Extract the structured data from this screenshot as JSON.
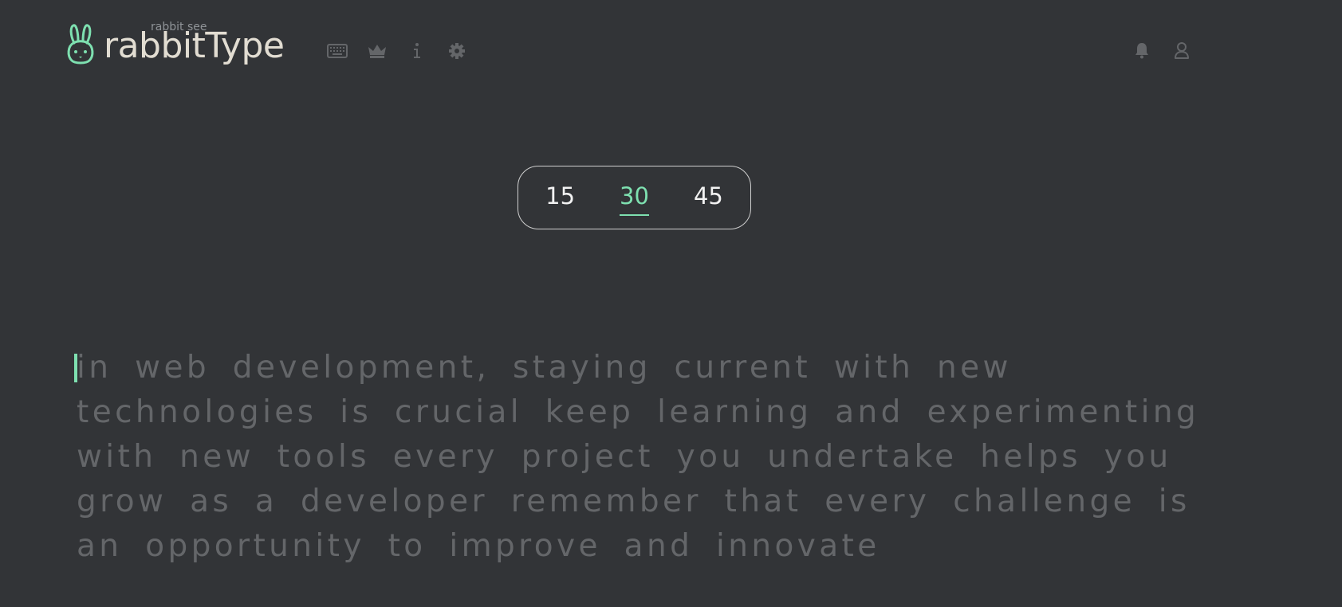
{
  "brand": {
    "subtitle": "rabbit see",
    "title": "rabbitType",
    "logo_icon": "rabbit-icon",
    "accent": "#7ee0b0"
  },
  "nav": {
    "icons": [
      "keyboard-icon",
      "crown-icon",
      "info-icon",
      "gear-icon"
    ],
    "right_icons": [
      "bell-icon",
      "user-icon"
    ]
  },
  "durations": {
    "options": [
      "15",
      "30",
      "45"
    ],
    "selected": "30"
  },
  "typing": {
    "lines": [
      "in web development, staying current with new",
      "technologies is crucial keep learning and experimenting",
      "with new tools every project you undertake helps you",
      "grow as a developer remember that every challenge is",
      "an opportunity to improve and innovate"
    ],
    "text_color": "#646669",
    "caret_color": "#7ee0b0"
  },
  "colors": {
    "background": "#323437",
    "title": "#e2ddd2",
    "icon": "#646669"
  }
}
